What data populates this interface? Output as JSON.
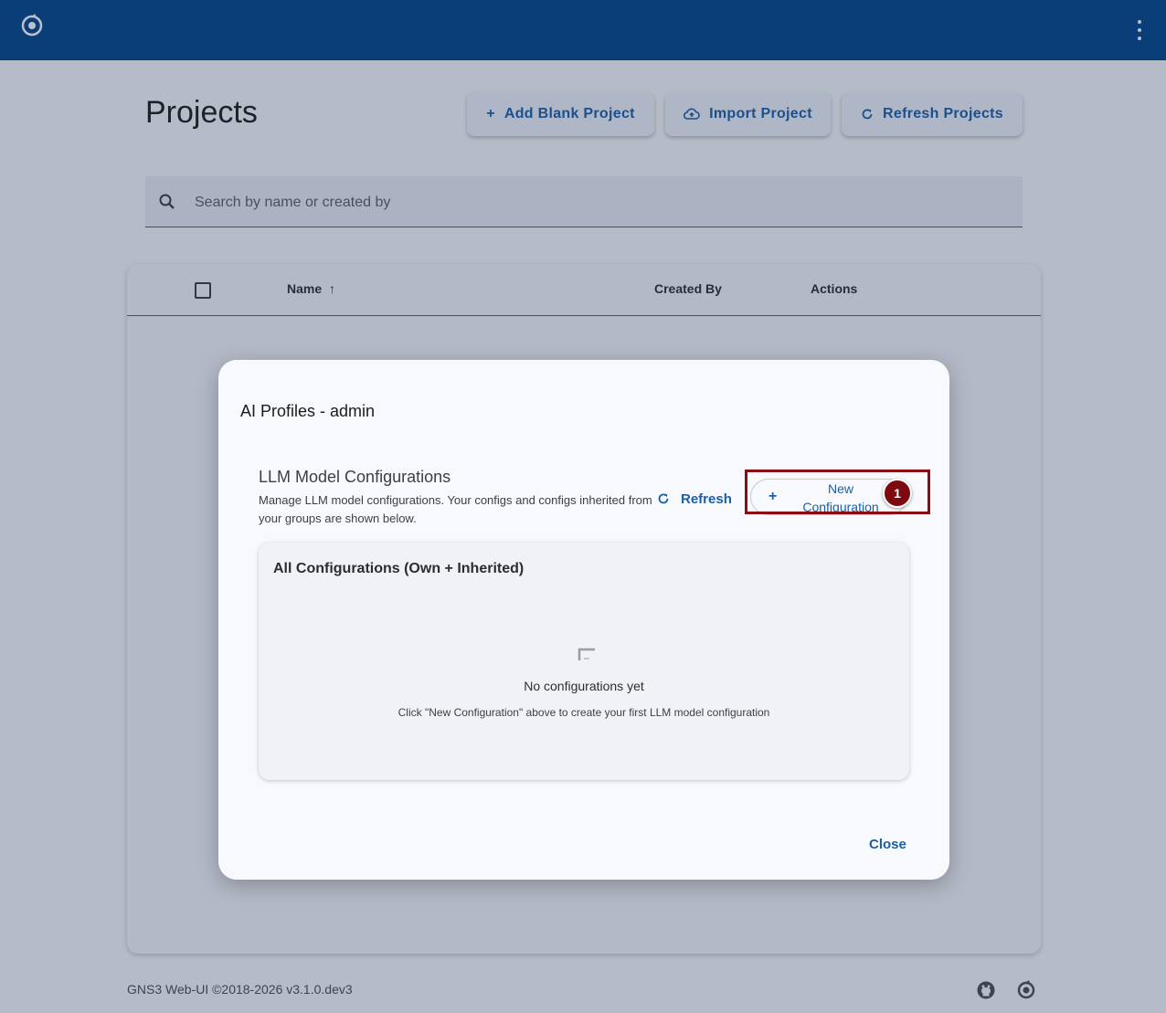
{
  "topbar": {
    "logo_icon": "gns3-logo-icon",
    "menu_icon": "more-vert-icon"
  },
  "page": {
    "title": "Projects",
    "buttons": {
      "add_blank": "Add Blank Project",
      "import": "Import Project",
      "refresh": "Refresh Projects"
    },
    "search": {
      "placeholder": "Search by name or created by",
      "value": ""
    },
    "table": {
      "columns": [
        "Name",
        "Created By",
        "Actions"
      ],
      "sort_indicator": "↑"
    },
    "footer": {
      "text": "GNS3 Web-UI ©2018-2026 v3.1.0.dev3"
    }
  },
  "dialog": {
    "title": "AI Profiles - admin",
    "section_title": "LLM Model Configurations",
    "section_desc": "Manage LLM model configurations. Your configs and configs inherited from your groups are shown below.",
    "refresh_label": "Refresh",
    "new_config_label": "New Configuration",
    "card_title": "All Configurations (Own + Inherited)",
    "empty_title": "No configurations yet",
    "empty_sub": "Click \"New Configuration\" above to create your first LLM model configuration",
    "close_label": "Close",
    "marker": "1"
  },
  "colors": {
    "topbar": "#00458a",
    "accent": "#1a5fa8",
    "highlight": "#8a0d12"
  }
}
